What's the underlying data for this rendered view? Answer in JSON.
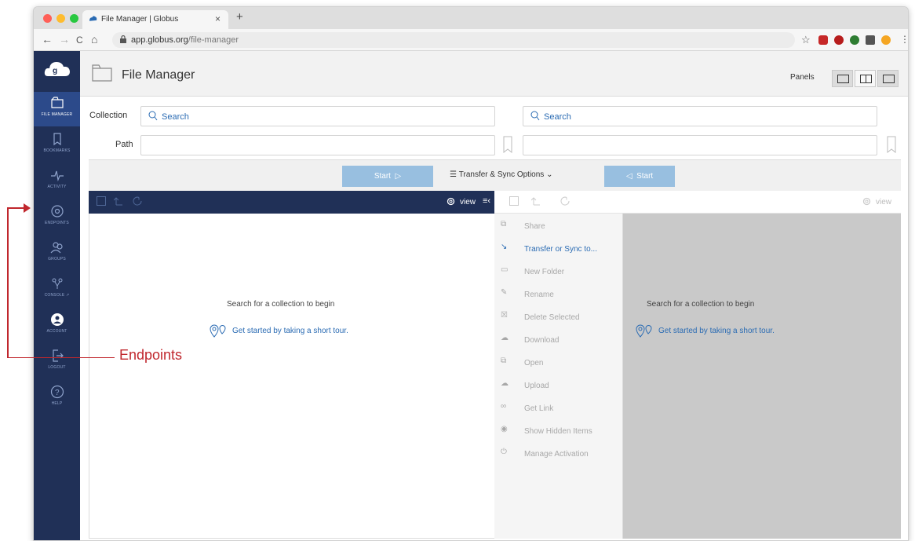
{
  "browser": {
    "tab_title": "File Manager | Globus",
    "tab_close": "×",
    "new_tab": "+",
    "url_host": "app.globus.org",
    "url_path": "/file-manager",
    "nav_back": "←",
    "nav_forward": "→",
    "nav_reload": "C",
    "nav_home": "⌂",
    "star": "☆",
    "menu": "⋮"
  },
  "sidebar": {
    "items": [
      {
        "label": "FILE MANAGER",
        "icon": "folder-icon"
      },
      {
        "label": "BOOKMARKS",
        "icon": "bookmark-icon"
      },
      {
        "label": "ACTIVITY",
        "icon": "activity-icon"
      },
      {
        "label": "ENDPOINTS",
        "icon": "endpoints-icon"
      },
      {
        "label": "GROUPS",
        "icon": "groups-icon"
      },
      {
        "label": "CONSOLE ↗",
        "icon": "console-icon"
      },
      {
        "label": "ACCOUNT",
        "icon": "account-icon"
      },
      {
        "label": "LOGOUT",
        "icon": "logout-icon"
      },
      {
        "label": "HELP",
        "icon": "help-icon"
      }
    ]
  },
  "header": {
    "title": "File Manager",
    "panels_label": "Panels"
  },
  "form": {
    "collection_label": "Collection",
    "path_label": "Path",
    "left_search_placeholder": "Search",
    "right_search_placeholder": "Search"
  },
  "actions": {
    "start_left": "Start",
    "transfer_options": "Transfer & Sync Options",
    "start_right": "Start"
  },
  "toolbar": {
    "view_left": "view",
    "view_right": "view",
    "menu_toggle": "≡‹"
  },
  "left_pane": {
    "message": "Search for a collection to begin",
    "tour_link": "Get started by taking a short tour."
  },
  "right_pane": {
    "message": "Search for a collection to begin",
    "tour_link": "Get started by taking a short tour."
  },
  "menu": {
    "items": [
      {
        "label": "Share",
        "enabled": false
      },
      {
        "label": "Transfer or Sync to...",
        "enabled": true
      },
      {
        "label": "New Folder",
        "enabled": false
      },
      {
        "label": "Rename",
        "enabled": false
      },
      {
        "label": "Delete Selected",
        "enabled": false
      },
      {
        "label": "Download",
        "enabled": false
      },
      {
        "label": "Open",
        "enabled": false
      },
      {
        "label": "Upload",
        "enabled": false
      },
      {
        "label": "Get Link",
        "enabled": false
      },
      {
        "label": "Show Hidden Items",
        "enabled": false
      },
      {
        "label": "Manage Activation",
        "enabled": false
      }
    ]
  },
  "annotation": {
    "label": "Endpoints",
    "color": "#c0272d"
  },
  "colors": {
    "sidebar_bg": "#203057",
    "sidebar_active": "#2c4a8a",
    "link": "#2a6bb3",
    "start_button": "#98bfe0",
    "pane_gray": "#c9c9c9"
  }
}
